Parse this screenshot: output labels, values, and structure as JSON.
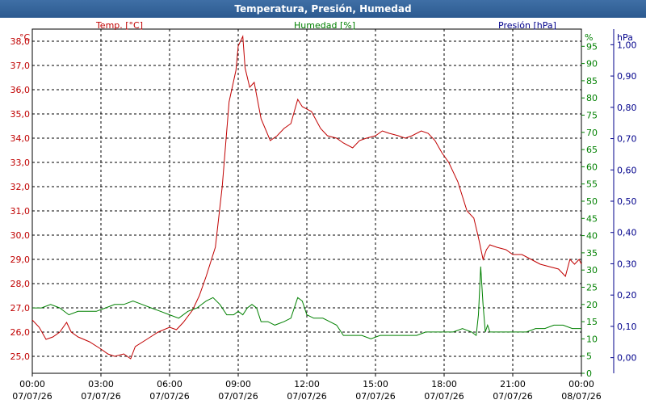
{
  "window": {
    "title": "Temperatura, Presión, Humedad"
  },
  "colors": {
    "temperature": "#c00000",
    "humidity": "#008000",
    "pressure": "#00008b",
    "grid": "#000000"
  },
  "chart_data": {
    "type": "line",
    "title": "Temperatura, Presión, Humedad",
    "grid": true,
    "x_ticks": [
      {
        "time": "00:00",
        "date": "07/07/26"
      },
      {
        "time": "03:00",
        "date": "07/07/26"
      },
      {
        "time": "06:00",
        "date": "07/07/26"
      },
      {
        "time": "09:00",
        "date": "07/07/26"
      },
      {
        "time": "12:00",
        "date": "07/07/26"
      },
      {
        "time": "15:00",
        "date": "07/07/26"
      },
      {
        "time": "18:00",
        "date": "07/07/26"
      },
      {
        "time": "21:00",
        "date": "07/07/26"
      },
      {
        "time": "00:00",
        "date": "08/07/26"
      }
    ],
    "axes": {
      "temperature": {
        "unit": "°C",
        "range": [
          24.3,
          38.5
        ],
        "ticks": [
          "25,0",
          "26,0",
          "27,0",
          "28,0",
          "29,0",
          "30,0",
          "31,0",
          "32,0",
          "33,0",
          "34,0",
          "35,0",
          "36,0",
          "37,0",
          "38,0"
        ],
        "tick_values": [
          25,
          26,
          27,
          28,
          29,
          30,
          31,
          32,
          33,
          34,
          35,
          36,
          37,
          38
        ]
      },
      "humidity": {
        "unit": "%",
        "range": [
          0,
          100
        ],
        "ticks": [
          "0",
          "5",
          "10",
          "15",
          "20",
          "25",
          "30",
          "35",
          "40",
          "45",
          "50",
          "55",
          "60",
          "65",
          "70",
          "75",
          "80",
          "85",
          "90",
          "95"
        ],
        "tick_values": [
          0,
          5,
          10,
          15,
          20,
          25,
          30,
          35,
          40,
          45,
          50,
          55,
          60,
          65,
          70,
          75,
          80,
          85,
          90,
          95
        ]
      },
      "pressure": {
        "unit": "hPa",
        "range": [
          -0.05,
          1.05
        ],
        "ticks": [
          "0,00",
          "0,10",
          "0,20",
          "0,30",
          "0,40",
          "0,50",
          "0,60",
          "0,70",
          "0,80",
          "0,90",
          "1,00"
        ],
        "tick_values": [
          0,
          0.1,
          0.2,
          0.3,
          0.4,
          0.5,
          0.6,
          0.7,
          0.8,
          0.9,
          1.0
        ]
      }
    },
    "series": [
      {
        "name": "Temp. [°C]",
        "axis": "temperature",
        "x": [
          0,
          0.3,
          0.6,
          0.9,
          1.2,
          1.5,
          1.7,
          2.0,
          2.5,
          3.0,
          3.3,
          3.6,
          4.0,
          4.3,
          4.5,
          5.0,
          5.5,
          6.0,
          6.3,
          6.6,
          7.0,
          7.3,
          7.6,
          8.0,
          8.3,
          8.6,
          8.9,
          9.0,
          9.2,
          9.3,
          9.5,
          9.7,
          10.0,
          10.4,
          10.7,
          11.0,
          11.3,
          11.6,
          11.8,
          12.2,
          12.6,
          12.9,
          13.3,
          13.6,
          14.0,
          14.3,
          14.6,
          15.0,
          15.3,
          15.6,
          16.0,
          16.3,
          16.6,
          17.0,
          17.3,
          17.6,
          17.9,
          18.2,
          18.6,
          19.0,
          19.3,
          19.5,
          19.7,
          19.85,
          20.0,
          20.3,
          20.7,
          21.0,
          21.4,
          21.8,
          22.2,
          22.6,
          23.0,
          23.3,
          23.5,
          23.7,
          23.9,
          24.0
        ],
        "y": [
          26.5,
          26.2,
          25.7,
          25.8,
          26.0,
          26.4,
          26.0,
          25.8,
          25.6,
          25.3,
          25.1,
          25.0,
          25.1,
          24.9,
          25.4,
          25.7,
          26.0,
          26.2,
          26.1,
          26.4,
          26.9,
          27.5,
          28.3,
          29.5,
          32.0,
          35.5,
          36.8,
          37.8,
          38.2,
          36.9,
          36.1,
          36.3,
          34.8,
          33.9,
          34.1,
          34.4,
          34.6,
          35.6,
          35.3,
          35.1,
          34.4,
          34.1,
          34.0,
          33.8,
          33.6,
          33.9,
          34.0,
          34.1,
          34.3,
          34.2,
          34.1,
          34.0,
          34.1,
          34.3,
          34.2,
          33.9,
          33.4,
          33.0,
          32.2,
          31.0,
          30.7,
          29.9,
          29.0,
          29.4,
          29.6,
          29.5,
          29.4,
          29.2,
          29.2,
          29.0,
          28.8,
          28.7,
          28.6,
          28.3,
          29.0,
          28.8,
          29.0,
          28.8
        ]
      },
      {
        "name": "Humedad [%]",
        "axis": "humidity",
        "x": [
          0,
          0.4,
          0.8,
          1.2,
          1.6,
          2.0,
          2.4,
          2.8,
          3.2,
          3.6,
          4.0,
          4.4,
          4.8,
          5.2,
          5.6,
          6.0,
          6.4,
          6.8,
          7.2,
          7.6,
          7.9,
          8.2,
          8.5,
          8.8,
          9.0,
          9.2,
          9.4,
          9.6,
          9.8,
          10.0,
          10.3,
          10.6,
          11.0,
          11.3,
          11.6,
          11.8,
          12.0,
          12.3,
          12.7,
          13.0,
          13.3,
          13.6,
          14.0,
          14.4,
          14.8,
          15.2,
          15.6,
          16.0,
          16.4,
          16.8,
          17.2,
          17.6,
          18.0,
          18.4,
          18.8,
          19.2,
          19.4,
          19.5,
          19.6,
          19.7,
          19.8,
          19.9,
          20.0,
          20.4,
          20.8,
          21.2,
          21.6,
          22.0,
          22.4,
          22.8,
          23.2,
          23.6,
          24.0
        ],
        "y": [
          19,
          19,
          20,
          19,
          17,
          18,
          18,
          18,
          19,
          20,
          20,
          21,
          20,
          19,
          18,
          17,
          16,
          18,
          19,
          21,
          22,
          20,
          17,
          17,
          18,
          17,
          19,
          20,
          19,
          15,
          15,
          14,
          15,
          16,
          22,
          21,
          17,
          16,
          16,
          15,
          14,
          11,
          11,
          11,
          10,
          11,
          11,
          11,
          11,
          11,
          12,
          12,
          12,
          12,
          13,
          12,
          11,
          17,
          31,
          20,
          12,
          14,
          12,
          12,
          12,
          12,
          12,
          13,
          13,
          14,
          14,
          13,
          13
        ]
      }
    ]
  }
}
